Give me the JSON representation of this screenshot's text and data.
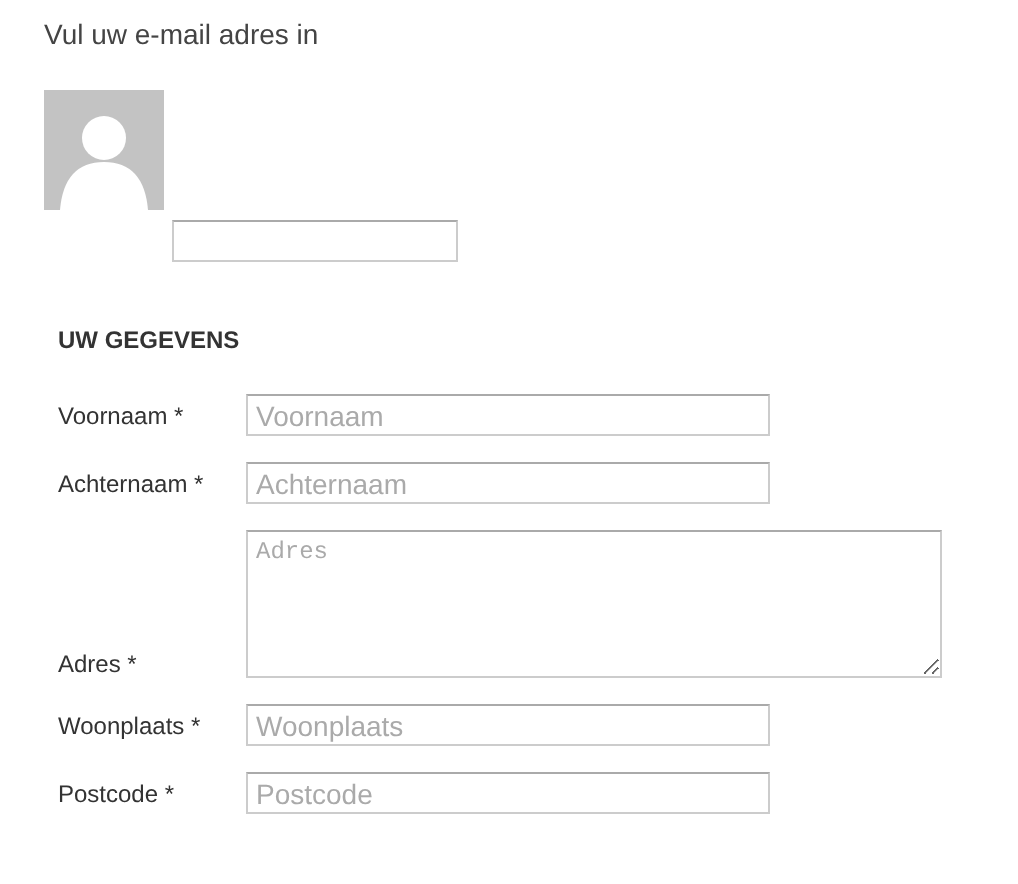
{
  "prompt": "Vul uw e-mail adres in",
  "section_title": "UW GEGEVENS",
  "fields": [
    {
      "kind": "input",
      "label": "Voornaam *",
      "placeholder": "Voornaam"
    },
    {
      "kind": "input",
      "label": "Achternaam *",
      "placeholder": "Achternaam"
    },
    {
      "kind": "textarea",
      "label": "Adres *",
      "placeholder": "Adres"
    },
    {
      "kind": "input",
      "label": "Woonplaats *",
      "placeholder": "Woonplaats"
    },
    {
      "kind": "input",
      "label": "Postcode *",
      "placeholder": "Postcode"
    }
  ]
}
